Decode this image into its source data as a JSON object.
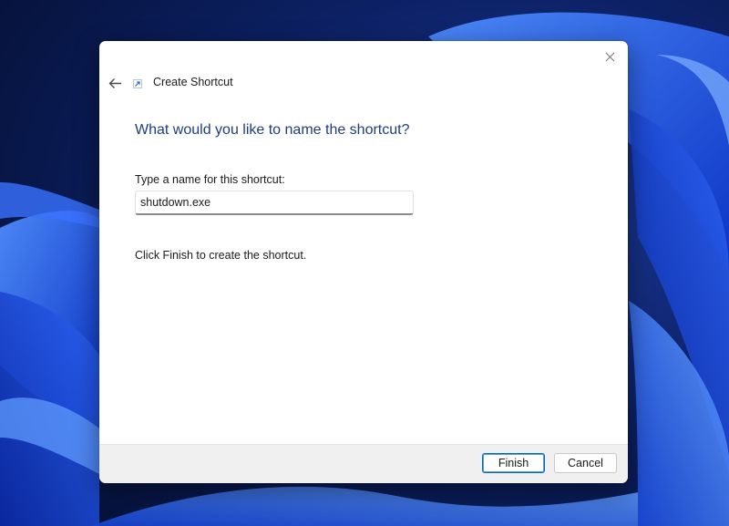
{
  "window": {
    "title": "Create Shortcut"
  },
  "wizard": {
    "heading": "What would you like to name the shortcut?",
    "field_label": "Type a name for this shortcut:",
    "name_value": "shutdown.exe",
    "instruction": "Click Finish to create the shortcut."
  },
  "buttons": {
    "finish_label": "Finish",
    "cancel_label": "Cancel"
  },
  "icons": {
    "back": "back-arrow-icon",
    "close": "close-icon",
    "title": "shortcut-icon"
  },
  "colors": {
    "heading": "#1f3d7a",
    "accent": "#0067c0",
    "footer_bg": "#f0f0f0",
    "wallpaper_dark": "#0a1a4a",
    "wallpaper_bright": "#2f6bff"
  }
}
